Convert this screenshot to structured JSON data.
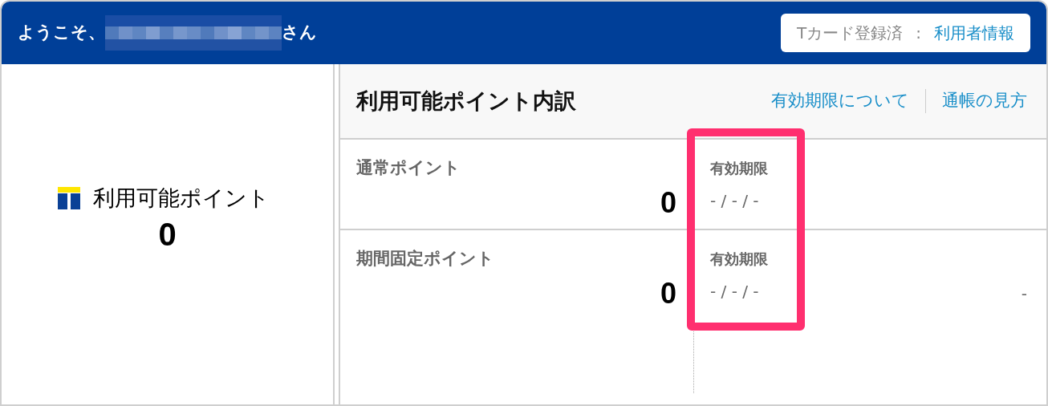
{
  "header": {
    "greeting_prefix": "ようこそ、",
    "greeting_suffix": "さん",
    "card_status": "Tカード登録済",
    "separator": ":",
    "user_info_link": "利用者情報"
  },
  "summary": {
    "label": "利用可能ポイント",
    "total": "0"
  },
  "breakdown": {
    "title": "利用可能ポイント内訳",
    "links": [
      "有効期限について",
      "通帳の見方"
    ],
    "rows": [
      {
        "name": "通常ポイント",
        "points": "0",
        "expiry_label": "有効期限",
        "expiry_date": "- / - / -"
      },
      {
        "name": "期間固定ポイント",
        "points": "0",
        "expiry_label": "有効期限",
        "expiry_date": "- / - / -",
        "column_4": "-"
      }
    ]
  }
}
